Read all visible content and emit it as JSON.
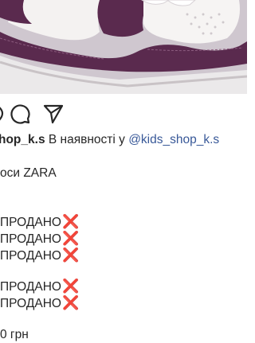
{
  "post": {
    "username": "hop_k.s",
    "caption_text": " В наявності у ",
    "mention": "@kids_shop_k.s",
    "title_line": "оси ZARA",
    "status_lines": [
      {
        "text": "ПРОДАНО",
        "mark": "❌"
      },
      {
        "text": "ПРОДАНО",
        "mark": "❌"
      },
      {
        "text": "ПРОДАНО",
        "mark": "❌"
      },
      {
        "text": "ПРОДАНО",
        "mark": "❌"
      },
      {
        "text": "ПРОДАНО",
        "mark": "❌"
      }
    ],
    "price_line": "0 грн"
  },
  "icons": {
    "comment": "comment-bubble-icon",
    "share": "share-paper-plane-icon"
  },
  "colors": {
    "sneaker_purple": "#5a2a4e",
    "sneaker_white": "#f2f0ef",
    "mention": "#385898",
    "cross": "#dd2e44"
  }
}
